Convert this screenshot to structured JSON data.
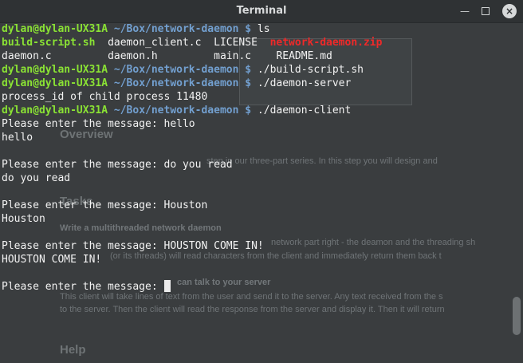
{
  "window": {
    "title": "Terminal"
  },
  "prompt": {
    "user": "dylan@dylan-UX31A",
    "path": "~/Box/network-daemon",
    "symbol": "$"
  },
  "commands": {
    "ls": "ls",
    "build": "./build-script.sh",
    "server": "./daemon-server",
    "client": "./daemon-client"
  },
  "ls_output": {
    "row1": [
      {
        "name": "build-script.sh",
        "kind": "exec"
      },
      {
        "name": "daemon_client.c",
        "kind": "file"
      },
      {
        "name": "LICENSE",
        "kind": "file"
      },
      {
        "name": "network-daemon.zip",
        "kind": "archive"
      }
    ],
    "row2": [
      {
        "name": "daemon.c",
        "kind": "file"
      },
      {
        "name": "daemon.h",
        "kind": "file"
      },
      {
        "name": "main.c",
        "kind": "file"
      },
      {
        "name": "README.md",
        "kind": "file"
      }
    ]
  },
  "server_output": "process_id of child process 11480",
  "session": [
    {
      "prompt": "Please enter the message: ",
      "input": "hello",
      "echo": "hello"
    },
    {
      "prompt": "Please enter the message: ",
      "input": "do you read",
      "echo": "do you read"
    },
    {
      "prompt": "Please enter the message: ",
      "input": "Houston",
      "echo": "Houston"
    },
    {
      "prompt": "Please enter the message: ",
      "input": "HOUSTON COME IN!",
      "echo": "HOUSTON COME IN!"
    }
  ],
  "final_prompt": "Please enter the message: ",
  "background": {
    "overview": "Overview",
    "overview_text": "step in our three-part series. In this step you will design and",
    "tasks": "Tasks",
    "task1": "Write a multithreaded network daemon",
    "task1_text1": "network part right - the deamon and the threading sh",
    "task1_text2": "(or its threads) will read characters from the client and immediately return them back t",
    "task2": "can talk to your server",
    "task2_text1": "This client will take lines of text from the user and send it to the server. Any text received from the s",
    "task2_text2": "to the server. Then the client will read the response from the server and display it. Then it will return",
    "help": "Help"
  }
}
